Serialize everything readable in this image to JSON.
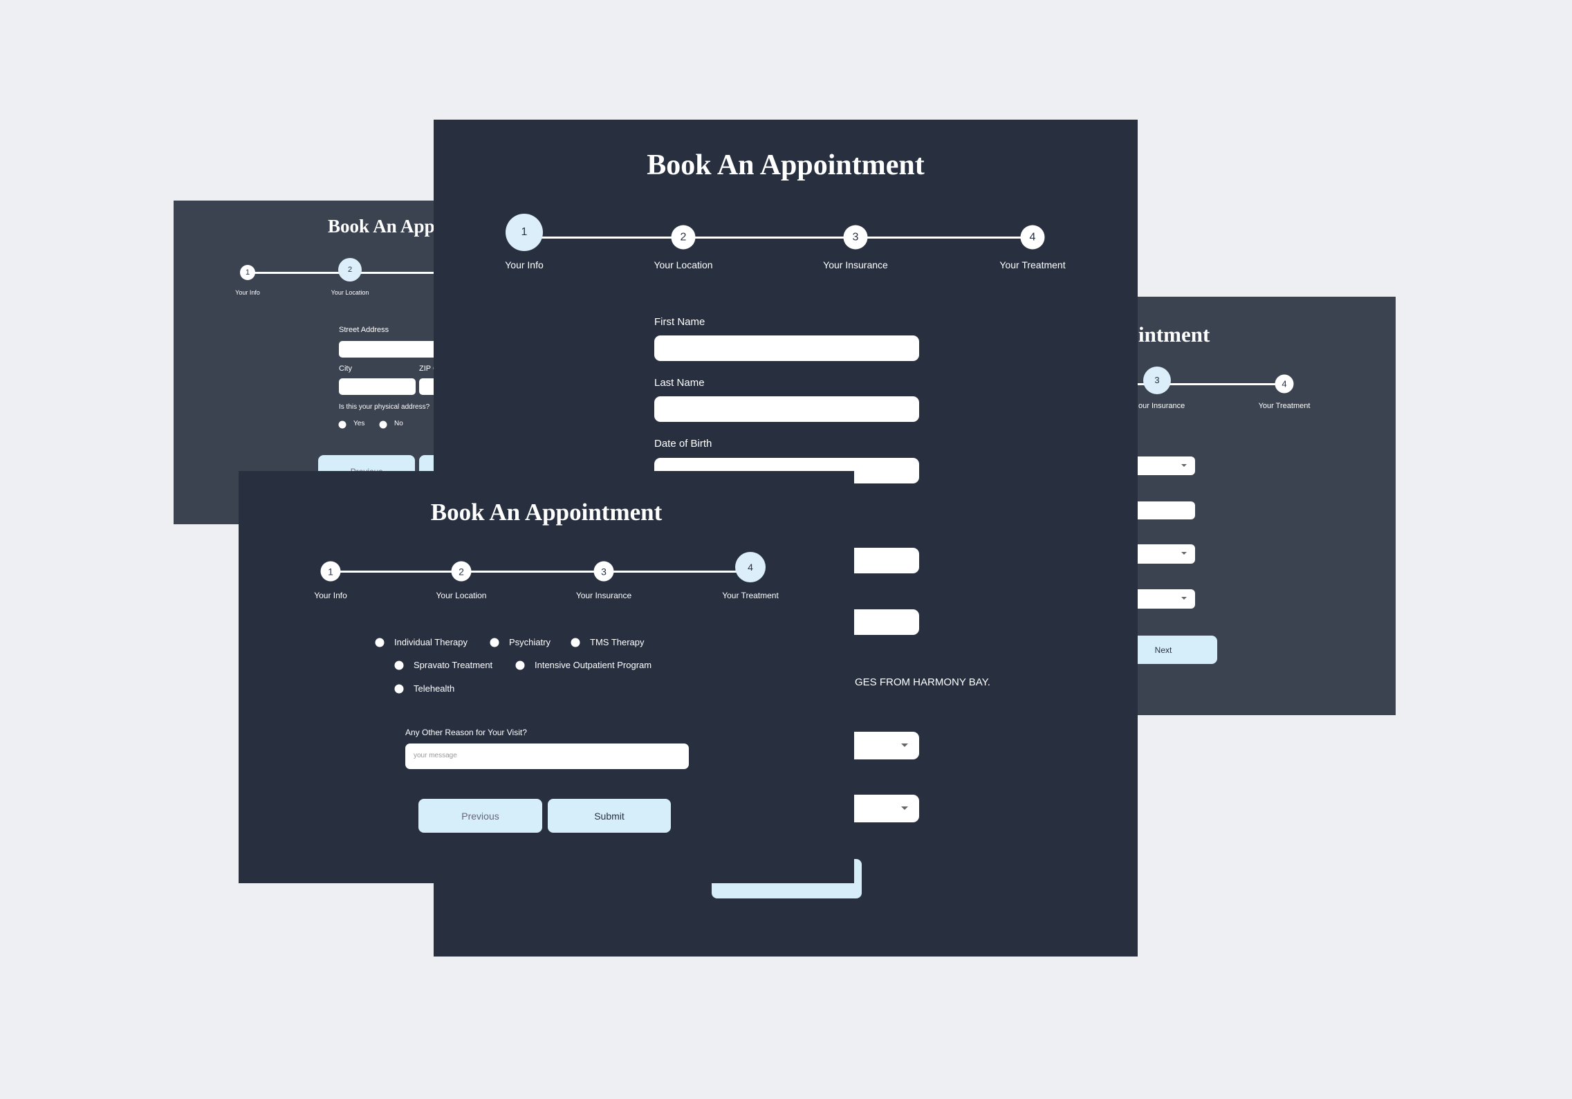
{
  "colors": {
    "background": "#eeeff2",
    "card_dark": "#283040",
    "card_back": "#3b4250",
    "accent": "#d6eefa"
  },
  "title": "Book An Appointment",
  "steps": [
    "Your Info",
    "Your Location",
    "Your Insurance",
    "Your Treatment"
  ],
  "step_numbers": [
    "1",
    "2",
    "3",
    "4"
  ],
  "card_location": {
    "active_step": 2,
    "street_label": "Street Address",
    "city_label": "City",
    "zip_label": "ZIP C",
    "physical_question": "Is this your physical address?",
    "options": [
      "Yes",
      "No"
    ],
    "previous_label": "Previous"
  },
  "card_insurance": {
    "active_step": 3,
    "title_visible": "intment",
    "step3_label_visible": "our Insurance",
    "next_label": "Next"
  },
  "card_info": {
    "active_step": 1,
    "first_name_label": "First Name",
    "last_name_label": "Last Name",
    "dob_label": "Date of Birth",
    "consent_text_visible": "GES FROM HARMONY BAY."
  },
  "card_treatment": {
    "active_step": 4,
    "treatments": [
      "Individual Therapy",
      "Psychiatry",
      "TMS Therapy",
      "Spravato Treatment",
      "Intensive Outpatient Program",
      "Telehealth"
    ],
    "reason_label": "Any Other Reason for Your Visit?",
    "reason_placeholder": "your message",
    "previous_label": "Previous",
    "submit_label": "Submit"
  }
}
